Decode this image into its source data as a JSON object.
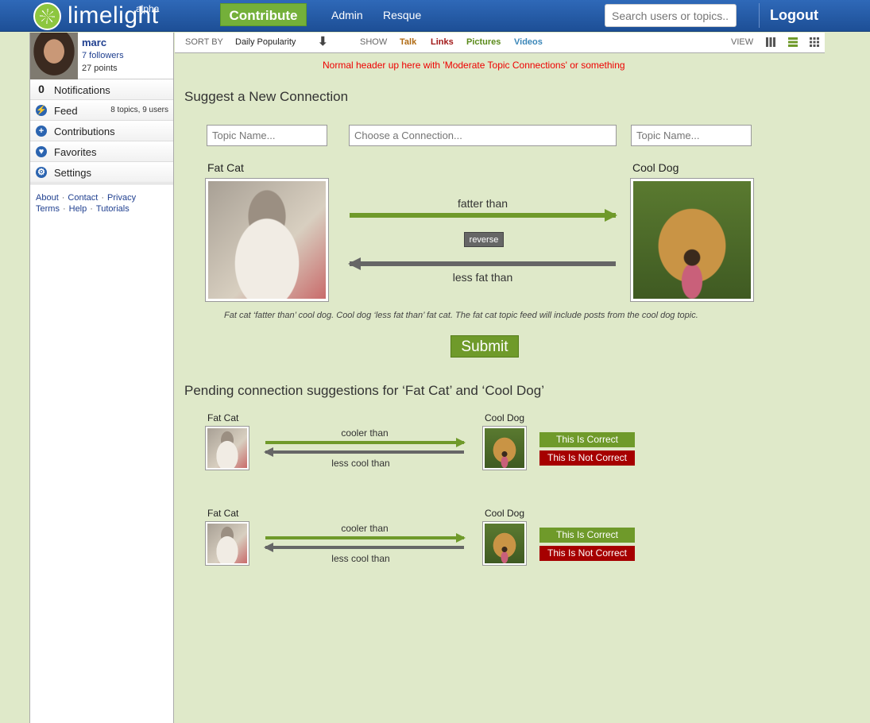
{
  "header": {
    "logo_text": "limelight",
    "logo_sup": "alpha",
    "contribute_label": "Contribute",
    "nav": [
      "Admin",
      "Resque"
    ],
    "search_placeholder": "Search users or topics...",
    "logout_label": "Logout"
  },
  "profile": {
    "name": "marc",
    "followers": "7 followers",
    "points": "27 points"
  },
  "sidebar": {
    "items": [
      {
        "label": "Notifications",
        "icon": "0",
        "icon_name": "notifications-count"
      },
      {
        "label": "Feed",
        "extra": "8 topics, 9 users",
        "icon_name": "feed-icon"
      },
      {
        "label": "Contributions",
        "icon_name": "plus-icon"
      },
      {
        "label": "Favorites",
        "icon_name": "heart-icon"
      },
      {
        "label": "Settings",
        "icon_name": "gear-icon"
      }
    ],
    "footer_row1": [
      "About",
      "Contact",
      "Privacy"
    ],
    "footer_row2": [
      "Terms",
      "Help",
      "Tutorials"
    ]
  },
  "sortbar": {
    "sort_label": "SORT BY",
    "sort_value": "Daily Popularity",
    "show_label": "SHOW",
    "filters": [
      {
        "label": "Talk",
        "color": "#b06a12"
      },
      {
        "label": "Links",
        "color": "#a11818"
      },
      {
        "label": "Pictures",
        "color": "#5a8a1a"
      },
      {
        "label": "Videos",
        "color": "#3a86b8"
      }
    ],
    "view_label": "VIEW"
  },
  "notice": "Normal header up here with 'Moderate Topic Connections' or something",
  "suggest": {
    "heading": "Suggest a New Connection",
    "topic_placeholder_left": "Topic Name...",
    "connection_placeholder": "Choose a Connection...",
    "topic_placeholder_right": "Topic Name...",
    "left_name": "Fat Cat",
    "right_name": "Cool Dog",
    "forward_label": "fatter than",
    "reverse_button": "reverse",
    "backward_label": "less fat than",
    "caption": "Fat cat ‘fatter than’ cool dog. Cool dog ‘less fat than’ fat cat. The fat cat topic feed will include posts from the cool dog topic.",
    "submit_label": "Submit"
  },
  "pending": {
    "heading": "Pending connection suggestions for ‘Fat Cat’ and ‘Cool Dog’",
    "rows": [
      {
        "left": "Fat Cat",
        "right": "Cool Dog",
        "forward": "cooler than",
        "backward": "less cool than",
        "correct": "This Is Correct",
        "not_correct": "This Is Not Correct"
      },
      {
        "left": "Fat Cat",
        "right": "Cool Dog",
        "forward": "cooler than",
        "backward": "less cool than",
        "correct": "This Is Correct",
        "not_correct": "This Is Not Correct"
      }
    ]
  }
}
